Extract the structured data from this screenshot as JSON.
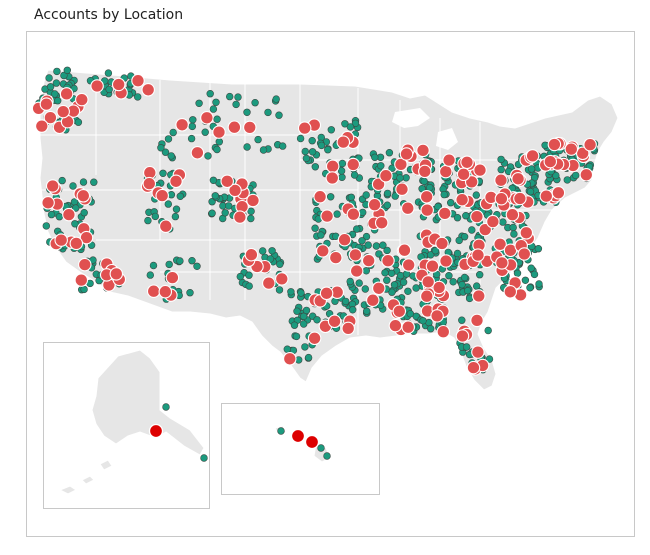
{
  "title": "Accounts by Location",
  "colors": {
    "category_a": "#1c9a7e",
    "category_b": "#e05050",
    "category_c": "#dd0000",
    "land": "#e6e6e6",
    "border": "#c8c8c8"
  }
}
